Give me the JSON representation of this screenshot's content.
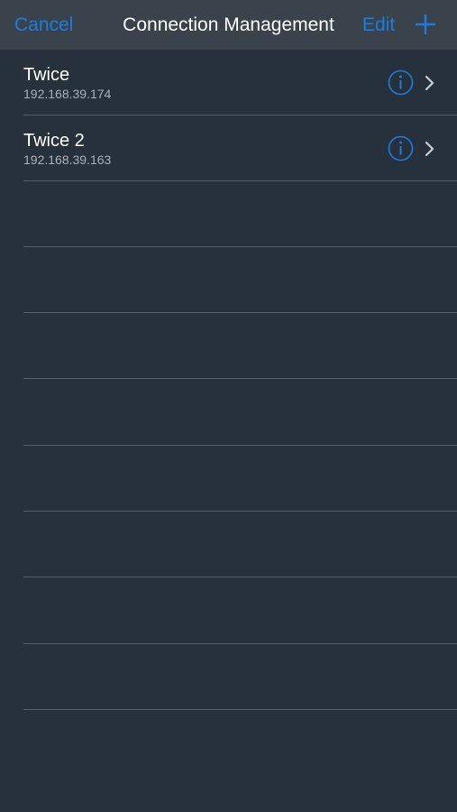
{
  "navbar": {
    "cancel_label": "Cancel",
    "title": "Connection Management",
    "edit_label": "Edit",
    "add_icon": "plus-icon"
  },
  "connections": [
    {
      "name": "Twice",
      "address": "192.168.39.174"
    },
    {
      "name": "Twice 2",
      "address": "192.168.39.163"
    }
  ],
  "colors": {
    "accent": "#1a7de0",
    "background": "#27313b",
    "navbar": "#3a434c",
    "separator": "#56606a"
  }
}
